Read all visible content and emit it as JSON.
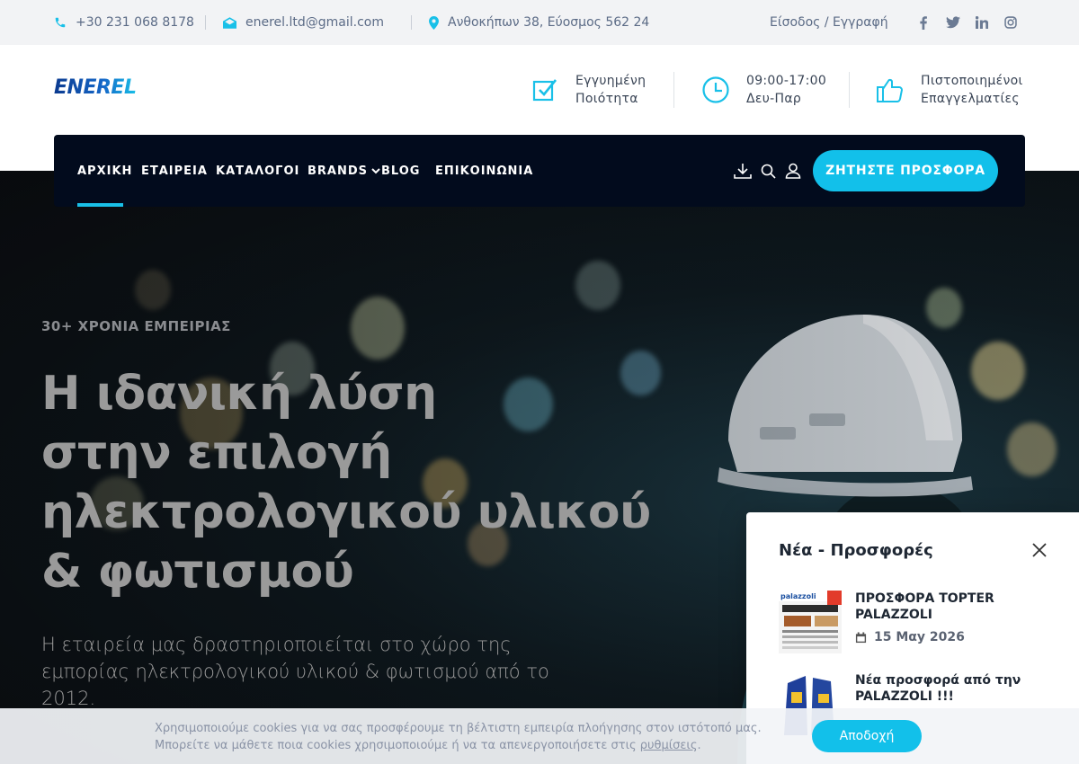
{
  "topbar": {
    "phone": "+30 231 068 8178",
    "email": "enerel.ltd@gmail.com",
    "address": "Ανθοκήπων 38, Εύοσμος 562 24",
    "login": "Είσοδος / Εγγραφή",
    "social": [
      "f",
      "t",
      "in",
      "ig"
    ]
  },
  "brand": {
    "logo": "ENEREL",
    "accent": "#12c0ea",
    "navy": "#020b1d"
  },
  "features": [
    {
      "icon": "checkbox-icon",
      "line1": "Εγγυημένη",
      "line2": "Ποιότητα"
    },
    {
      "icon": "clock-icon",
      "line1": "09:00-17:00",
      "line2": "Δευ-Παρ"
    },
    {
      "icon": "thumbs-up-icon",
      "line1": "Πιστοποιημένοι",
      "line2": "Επαγγελματίες"
    }
  ],
  "nav": {
    "items": [
      "ΑΡΧΙΚΗ",
      "ΕΤΑΙΡΕΙΑ",
      "ΚΑΤΑΛΟΓΟΙ",
      "BRANDS",
      "BLOG",
      "ΕΠΙΚΟΙΝΩΝΙΑ"
    ],
    "active": "ΑΡΧΙΚΗ",
    "cta": "ΖΗΤΗΣΤΕ ΠΡΟΣΦΟΡΑ"
  },
  "hero": {
    "kicker": "30+ ΧΡΟΝΙΑ ΕΜΠΕΙΡΙΑΣ",
    "title_lines": [
      "Η ιδανική λύση",
      "στην επιλογή",
      "ηλεκτρολογικού υλικού",
      "& φωτισμού"
    ],
    "text": "Η εταιρεία μας δραστηριοποιείται στο χώρο της εμπορίας ηλεκτρολογικού υλικού & φωτισμού από το 2012."
  },
  "popup": {
    "title": "Νέα - Προσφορές",
    "offers": [
      {
        "title": "ΠΡΟΣΦΟΡΑ TOPTER PALAZZOLI",
        "date": "15 Μαy 2026",
        "thumb_text": "palazzoli"
      },
      {
        "title": "Νέα προσφορά από την PALAZZOLI !!!",
        "date": "",
        "thumb_text": ""
      }
    ]
  },
  "cookie": {
    "text": "Χρησιμοποιούμε cookies για να σας προσφέρουμε τη βέλτιστη εμπειρία πλοήγησης στον ιστότοπό μας. Μπορείτε να μάθετε ποια cookies χρησιμοποιούμε ή να τα απενεργοποιήσετε στις",
    "link": "ρυθμίσεις",
    "button": "Αποδοχή"
  }
}
